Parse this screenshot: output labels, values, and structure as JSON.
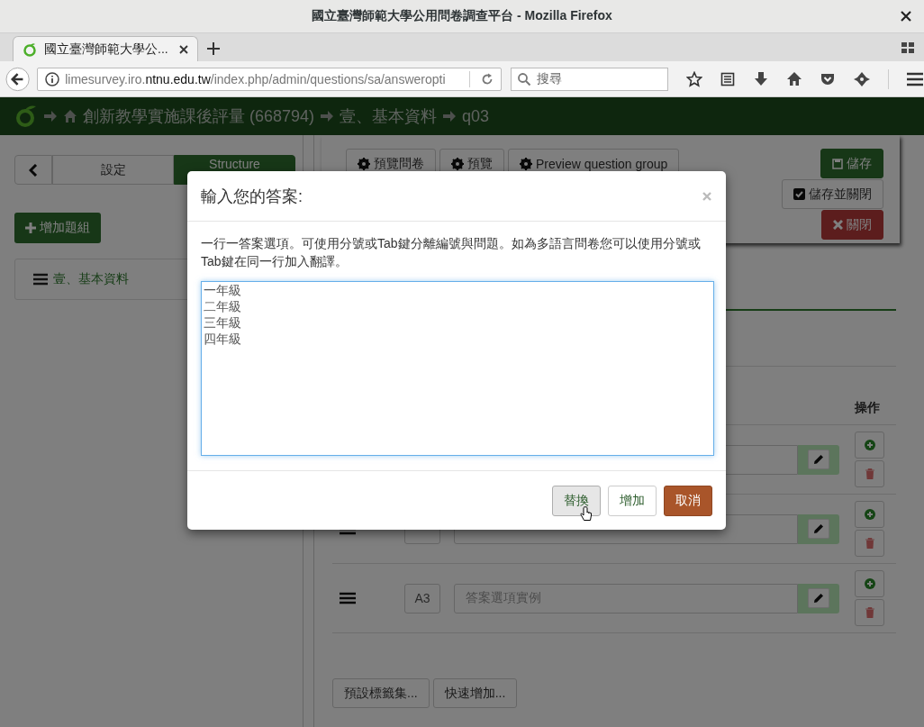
{
  "window": {
    "title": "國立臺灣師範大學公用問卷調查平台 - Mozilla Firefox"
  },
  "browser": {
    "tabs": [
      {
        "label": "國立臺灣師範大學公...",
        "selected": true
      }
    ],
    "url": {
      "prefix": "limesurvey.iro.",
      "domain": "ntnu.edu.tw",
      "path": "/index.php/admin/questions/sa/answeropti"
    },
    "search": {
      "placeholder": "搜尋"
    }
  },
  "breadcrumb": [
    "創新教學實施課後評量 (668794)",
    "壹、基本資料",
    "q03"
  ],
  "sidebar": {
    "tabs": [
      {
        "label": "設定",
        "selected": false
      },
      {
        "label": "Structure",
        "selected": true
      }
    ],
    "add_button": "增加題組",
    "groups": [
      "壹、基本資料"
    ]
  },
  "toolbar": {
    "buttons": [
      "預覽問卷",
      "預覽",
      "Preview question group"
    ],
    "save": "儲存",
    "save_close": "儲存並關閉",
    "close": "關閉"
  },
  "answers": {
    "action_header": "操作",
    "rows": [
      {
        "kind": "partial"
      },
      {
        "kind": "full"
      },
      {
        "kind": "full",
        "code": "A3",
        "placeholder": "答案選項實例"
      }
    ]
  },
  "bottom_buttons": [
    "預設標籤集...",
    "快速增加..."
  ],
  "modal": {
    "title": "輸入您的答案:",
    "help": "一行一答案選項。可使用分號或Tab鍵分離編號與問題。如為多語言問卷您可以使用分號或Tab鍵在同一行加入翻譯。",
    "lines": [
      "一年級",
      "二年級",
      "三年級",
      "四年級"
    ],
    "buttons": [
      {
        "label": "替換",
        "kind": "default",
        "hover": true
      },
      {
        "label": "增加",
        "kind": "default",
        "hover": false
      },
      {
        "label": "取消",
        "kind": "cancel",
        "hover": false
      }
    ]
  }
}
